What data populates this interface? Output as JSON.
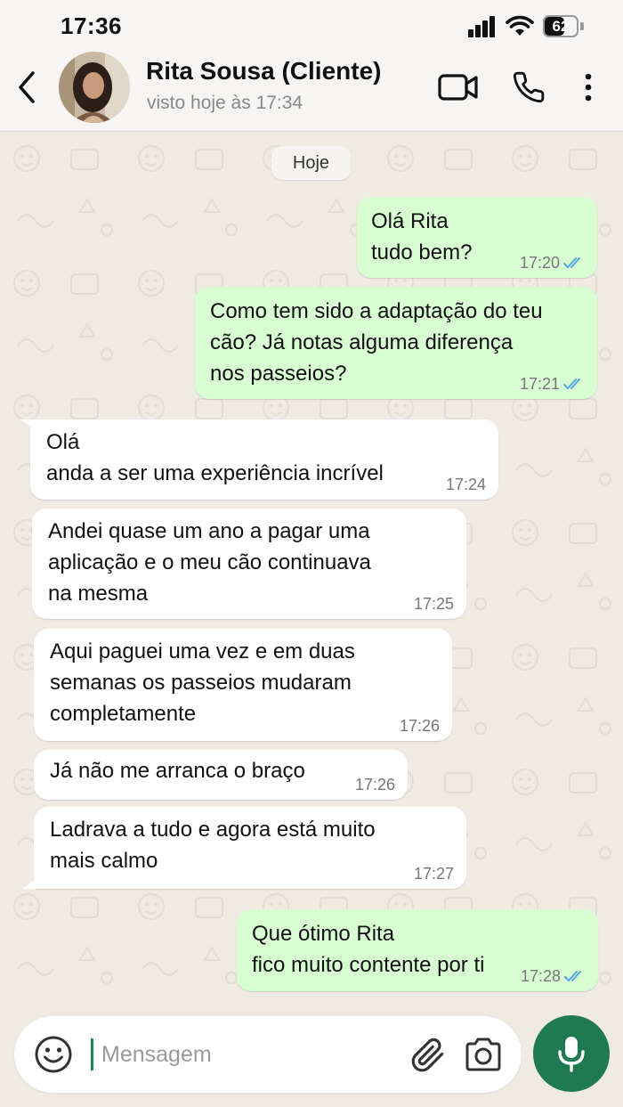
{
  "status_bar": {
    "time": "17:36",
    "battery": "62",
    "battery_level": 0.62
  },
  "header": {
    "contact_name": "Rita Sousa (Cliente)",
    "contact_status": "visto hoje às 17:34",
    "icons": [
      "chevron-left-icon",
      "video-call-icon",
      "phone-icon",
      "more-vertical-icon"
    ]
  },
  "chat": {
    "date_chip": "Hoje",
    "messages": [
      {
        "direction": "out",
        "text": "Olá Rita\ntudo bem?",
        "time": "17:20",
        "read": true
      },
      {
        "direction": "out",
        "text": "Como tem sido a adaptação do teu\ncão? Já notas alguma diferença\nnos passeios?",
        "time": "17:21",
        "read": true
      },
      {
        "direction": "in",
        "text": "Olá\nanda a ser uma experiência incrível",
        "time": "17:24"
      },
      {
        "direction": "in",
        "text": "Andei quase um ano a pagar uma\naplicação e o meu cão continuava\nna mesma",
        "time": "17:25"
      },
      {
        "direction": "in",
        "text": "Aqui paguei uma vez e em duas\nsemanas os passeios mudaram\ncompletamente",
        "time": "17:26"
      },
      {
        "direction": "in",
        "text": "Já não me arranca o braço",
        "time": "17:26"
      },
      {
        "direction": "in",
        "text": "Ladrava a tudo e agora está muito\nmais calmo",
        "time": "17:27"
      },
      {
        "direction": "out",
        "text": "Que ótimo Rita\nfico muito contente por ti",
        "time": "17:28",
        "read": true
      }
    ]
  },
  "composer": {
    "placeholder": "Mensagem",
    "icons": [
      "emoji-icon",
      "paperclip-icon",
      "camera-icon",
      "microphone-icon"
    ]
  },
  "colors": {
    "outgoing_bubble": "#d9fdd3",
    "incoming_bubble": "#ffffff",
    "chat_background": "#efeae2",
    "read_ticks": "#53a6e0",
    "mic_button": "#1f7a52"
  }
}
